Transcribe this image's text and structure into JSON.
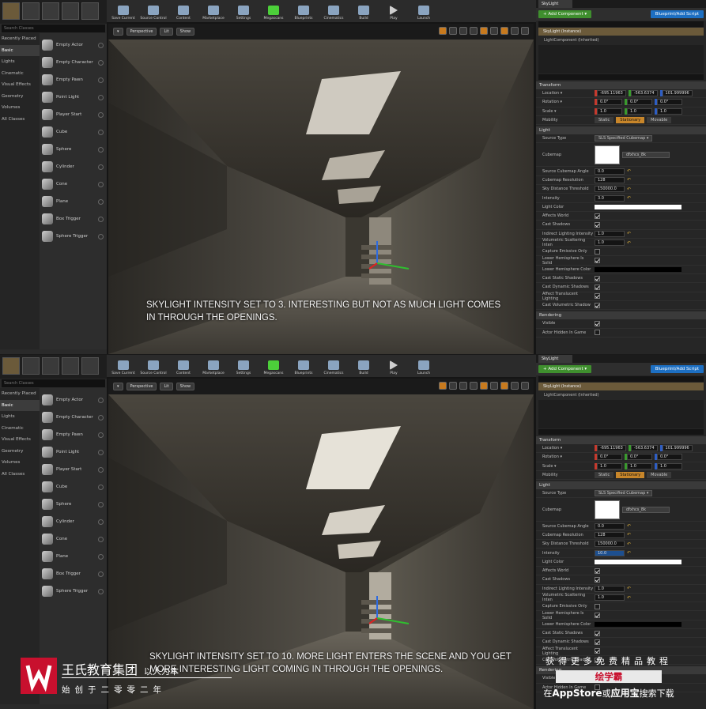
{
  "modes_panel": {
    "search_placeholder": "Search Classes",
    "categories": [
      "Recently Placed",
      "Basic",
      "Lights",
      "Cinematic",
      "Visual Effects",
      "Geometry",
      "Volumes",
      "All Classes"
    ],
    "items": [
      "Empty Actor",
      "Empty Character",
      "Empty Pawn",
      "Point Light",
      "Player Start",
      "Cube",
      "Sphere",
      "Cylinder",
      "Cone",
      "Plane",
      "Box Trigger",
      "Sphere Trigger"
    ]
  },
  "toolbar": {
    "buttons": [
      "Save Current",
      "Source Control",
      "Content",
      "Marketplace",
      "Settings",
      "Megascans",
      "Blueprints",
      "Cinematics",
      "Build",
      "Play",
      "Launch"
    ]
  },
  "viewport": {
    "perspective_label": "Perspective",
    "lit_label": "Lit",
    "show_label": "Show"
  },
  "panels": [
    {
      "caption": "SKYLIGHT INTENSITY SET TO 3. INTERESTING BUT NOT AS MUCH LIGHT COMES IN THROUGH THE OPENINGS.",
      "intensity": "3.0"
    },
    {
      "caption": "SKYLIGHT INTENSITY SET TO 10. MORE LIGHT ENTERS THE SCENE AND YOU GET MORE INTERESTING LIGHT COMING IN THROUGH THE OPENINGS.",
      "intensity": "10.0"
    }
  ],
  "details": {
    "tab_label": "SkyLight",
    "add_component": "+ Add Component ▾",
    "blueprint_button": "Blueprint/Add Script",
    "root_component": "SkyLight (Instance)",
    "child_component": "LightComponent (Inherited)",
    "transform_section": "Transform",
    "location_label": "Location ▾",
    "location": [
      "-695.11963",
      "-563.6374",
      "101.999996"
    ],
    "rotation_label": "Rotation ▾",
    "rotation": [
      "0.0°",
      "0.0°",
      "0.0°"
    ],
    "scale_label": "Scale ▾",
    "scale": [
      "1.0",
      "1.0",
      "1.0"
    ],
    "mobility_label": "Mobility",
    "mobility": [
      "Static",
      "Stationary",
      "Movable"
    ],
    "light_section": "Light",
    "source_type_label": "Source Type",
    "source_type": "SLS Specified Cubemap ▾",
    "cubemap_label": "Cubemap",
    "cubemap_value": "dfxhcs_8k",
    "cubemap_angle_label": "Source Cubemap Angle",
    "cubemap_angle": "0.0",
    "cubemap_resolution_label": "Cubemap Resolution",
    "cubemap_resolution": "128",
    "sky_distance_label": "Sky Distance Threshold",
    "sky_distance": "150000.0",
    "intensity_label": "Intensity",
    "light_color_label": "Light Color",
    "affects_world_label": "Affects World",
    "cast_shadows_label": "Cast Shadows",
    "indirect_label": "Indirect Lighting Intensity",
    "indirect_value": "1.0",
    "volumetric_label": "Volumetric Scattering Inten",
    "volumetric_value": "1.0",
    "capture_emissive_label": "Capture Emissive Only",
    "lower_hemi_label": "Lower Hemisphere Is Solid",
    "lower_hemi_color_label": "Lower Hemisphere Color",
    "cast_static_label": "Cast Static Shadows",
    "cast_dynamic_label": "Cast Dynamic Shadows",
    "affect_translucent_label": "Affect Translucent Lighting",
    "cast_volumetric_label": "Cast Volumetric Shadow",
    "rendering_section": "Rendering",
    "visible_label": "Visible",
    "actor_hidden_label": "Actor Hidden In Game"
  },
  "watermark": {
    "company": "王氏教育集团",
    "company_extra": "以人为本",
    "since": "始创于二零零二年",
    "right_top": "获得更多免费精品教程",
    "right_name": "绘学霸",
    "right_bottom_prefix": "在",
    "right_bottom_store1": "AppStore",
    "right_bottom_mid": "或",
    "right_bottom_store2": "应用宝",
    "right_bottom_suffix": "搜索下载"
  },
  "colors": {
    "accent_green": "#3f8f2e",
    "accent_blue": "#1d6fc2",
    "accent_orange": "#c8862a",
    "brand_red": "#c8102e"
  }
}
